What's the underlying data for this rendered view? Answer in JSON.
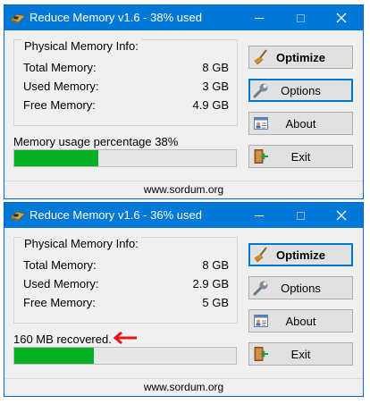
{
  "colors": {
    "titlebar": "#0078d7",
    "progress_fill": "#06b025",
    "arrow": "#e8141b"
  },
  "windows": [
    {
      "title": "Reduce Memory v1.6 - 38% used",
      "group_title": "Physical Memory Info:",
      "rows": [
        {
          "label": "Total Memory:",
          "value": "8 GB"
        },
        {
          "label": "Used Memory:",
          "value": "3 GB"
        },
        {
          "label": "Free Memory:",
          "value": "4.9 GB"
        }
      ],
      "status_text": "Memory usage percentage 38%",
      "progress_fraction": 0.38,
      "buttons": {
        "optimize": "Optimize",
        "options": "Options",
        "about": "About",
        "exit": "Exit"
      },
      "default_button": "options",
      "footer": "www.sordum.org"
    },
    {
      "title": "Reduce Memory v1.6 - 36% used",
      "group_title": "Physical Memory Info:",
      "rows": [
        {
          "label": "Total Memory:",
          "value": "8 GB"
        },
        {
          "label": "Used Memory:",
          "value": "2.9 GB"
        },
        {
          "label": "Free Memory:",
          "value": "5 GB"
        }
      ],
      "status_text": "160 MB recovered.",
      "progress_fraction": 0.36,
      "buttons": {
        "optimize": "Optimize",
        "options": "Options",
        "about": "About",
        "exit": "Exit"
      },
      "default_button": "optimize",
      "footer": "www.sordum.org"
    }
  ],
  "icons": {
    "app": "memory-chip-icon",
    "optimize": "broom-icon",
    "options": "wrench-icon",
    "about": "id-card-icon",
    "exit": "exit-door-icon",
    "status_arrow": "red-arrow-left-icon"
  }
}
